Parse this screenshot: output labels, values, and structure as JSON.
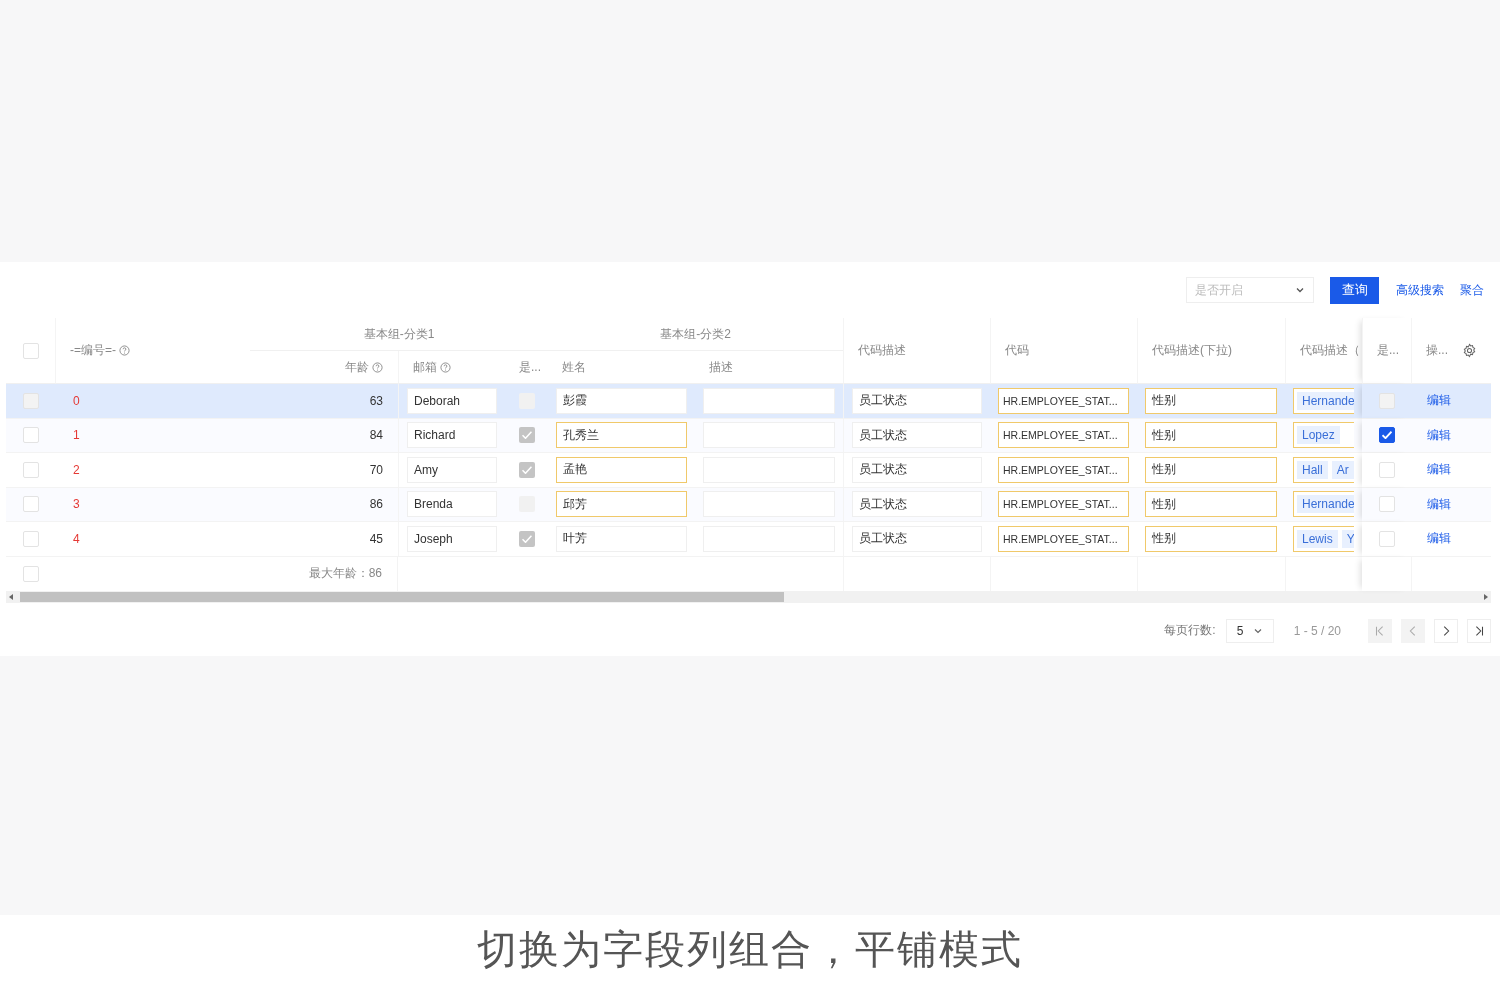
{
  "toolbar": {
    "filter": {
      "placeholder": "是否开启"
    },
    "query_button": "查询",
    "links": [
      "高级搜索",
      "聚合"
    ]
  },
  "table": {
    "select_all_checked": false,
    "summary_checked": false,
    "groups": [
      "基本组-分类1",
      "基本组-分类2"
    ],
    "columns": {
      "id": "-=编号=-",
      "age": "年龄",
      "email": "邮箱",
      "flag": "是...",
      "name": "姓名",
      "desc": "描述",
      "code_desc": "代码描述",
      "code": "代码",
      "code_select": "代码描述(下拉)",
      "code_multi": "代码描述（",
      "enabled": "是...",
      "actions": "操..."
    },
    "rows": [
      {
        "selected": true,
        "checked": false,
        "id": "0",
        "age": "63",
        "email": "Deborah",
        "flag": false,
        "name": "彭霞",
        "name_modified": false,
        "code_desc": "员工状态",
        "code": "HR.EMPLOYEE_STAT...",
        "code_select": "性别",
        "tags": [
          "Hernande"
        ],
        "enabled": false,
        "action": "编辑"
      },
      {
        "selected": false,
        "checked": false,
        "id": "1",
        "age": "84",
        "email": "Richard",
        "flag": true,
        "name": "孔秀兰",
        "name_modified": true,
        "code_desc": "员工状态",
        "code": "HR.EMPLOYEE_STAT...",
        "code_select": "性别",
        "tags": [
          "Lopez"
        ],
        "enabled": true,
        "action": "编辑"
      },
      {
        "selected": false,
        "checked": false,
        "id": "2",
        "age": "70",
        "email": "Amy",
        "flag": true,
        "name": "孟艳",
        "name_modified": true,
        "code_desc": "员工状态",
        "code": "HR.EMPLOYEE_STAT...",
        "code_select": "性别",
        "tags": [
          "Hall",
          "Ar"
        ],
        "enabled": false,
        "action": "编辑"
      },
      {
        "selected": false,
        "checked": false,
        "id": "3",
        "age": "86",
        "email": "Brenda",
        "flag": false,
        "name": "邱芳",
        "name_modified": true,
        "code_desc": "员工状态",
        "code": "HR.EMPLOYEE_STAT...",
        "code_select": "性别",
        "tags": [
          "Hernande"
        ],
        "enabled": false,
        "action": "编辑"
      },
      {
        "selected": false,
        "checked": false,
        "id": "4",
        "age": "45",
        "email": "Joseph",
        "flag": true,
        "name": "叶芳",
        "name_modified": false,
        "code_desc": "员工状态",
        "code": "HR.EMPLOYEE_STAT...",
        "code_select": "性别",
        "tags": [
          "Lewis",
          "Y"
        ],
        "enabled": false,
        "action": "编辑"
      }
    ],
    "summary": "最大年龄：86"
  },
  "pagination": {
    "rows_label": "每页行数:",
    "page_size": "5",
    "range": "1 - 5 / 20",
    "first_disabled": true,
    "prev_disabled": true,
    "next_disabled": false,
    "last_disabled": false
  },
  "caption": "切换为字段列组合，平铺模式"
}
